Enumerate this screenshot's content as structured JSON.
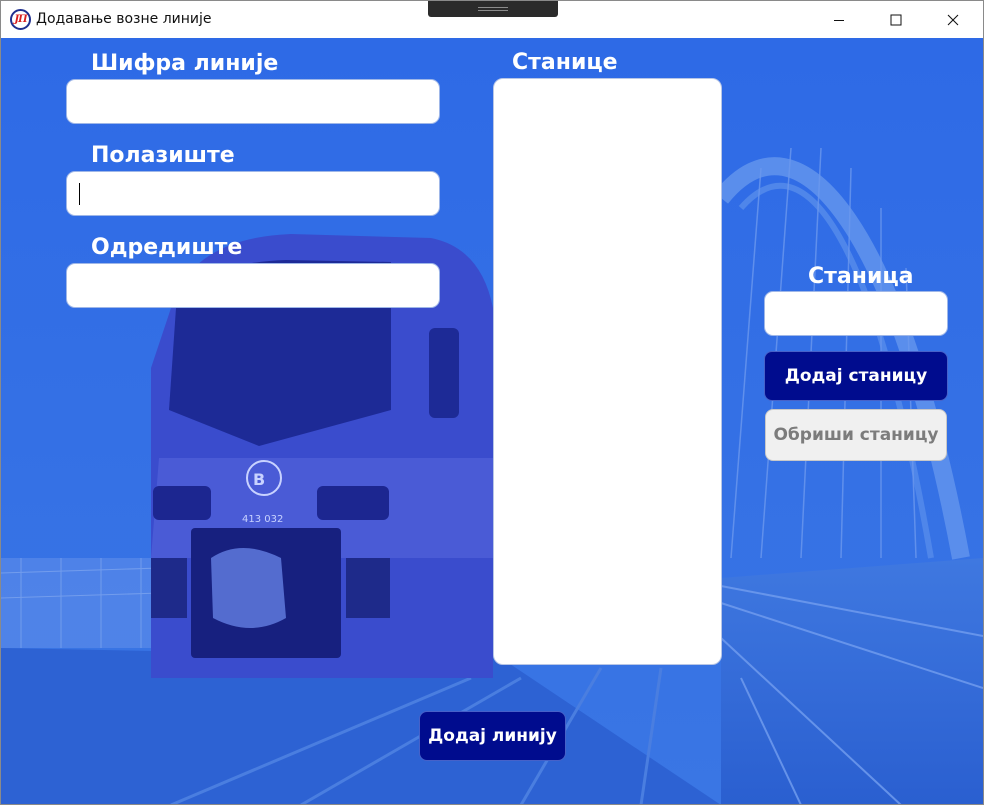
{
  "window": {
    "title": "Додавање возне линије",
    "icon": "jp-logo-icon",
    "controls": [
      "minimize-icon",
      "maximize-icon",
      "close-icon"
    ]
  },
  "form": {
    "line_code": {
      "label": "Шифра линије",
      "value": ""
    },
    "departure": {
      "label": "Полазиште",
      "value": ""
    },
    "destination": {
      "label": "Одредиште",
      "value": ""
    }
  },
  "stations": {
    "label": "Станице",
    "items": []
  },
  "station_input": {
    "label": "Станица",
    "value": ""
  },
  "buttons": {
    "add_station": "Додај станицу",
    "remove_station": "Обриши станицу",
    "add_line": "Додај линију"
  },
  "background": {
    "train_number": "413 032"
  },
  "colors": {
    "overlay": "#2f6be2",
    "primary_button": "#000c8e",
    "disabled_button": "#f0f0f0",
    "label_text": "#ffffff"
  }
}
